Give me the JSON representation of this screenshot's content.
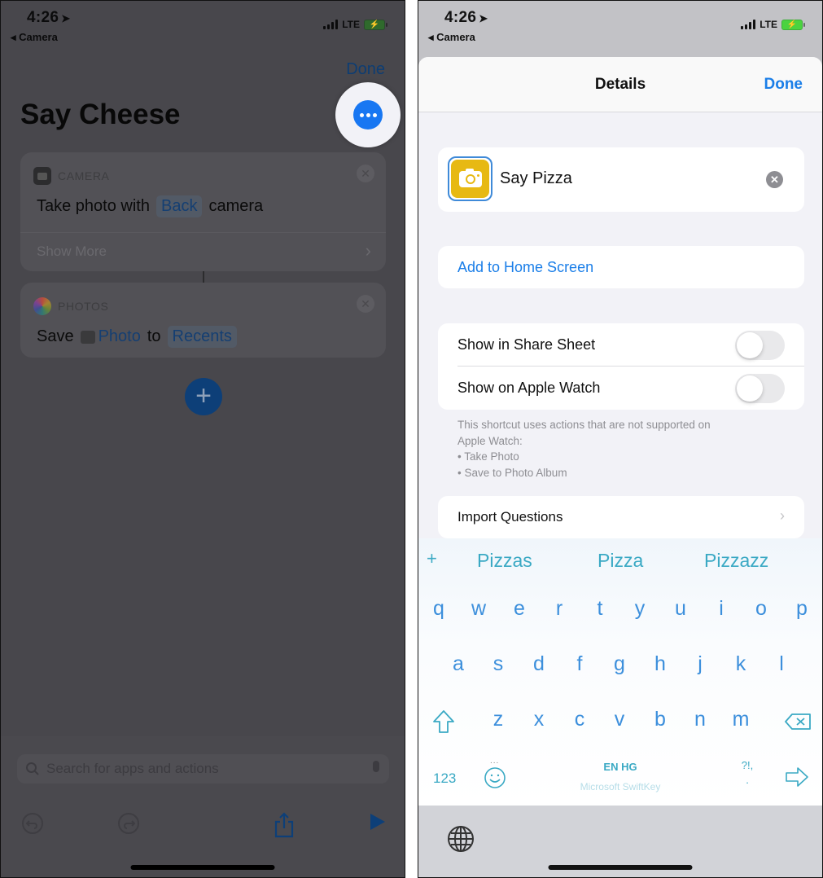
{
  "left_screen": {
    "status_bar": {
      "time": "4:26",
      "back_label": "◂ Camera",
      "network": "LTE"
    },
    "done_label": "Done",
    "title": "Say Cheese",
    "more_button_icon": "ellipsis-icon",
    "actions": [
      {
        "app": "CAMERA",
        "icon": "camera-app-icon",
        "text_before": "Take photo with",
        "param": "Back",
        "text_after": "camera",
        "show_more_label": "Show More"
      },
      {
        "app": "PHOTOS",
        "icon": "photos-app-icon",
        "text_before": "Save",
        "param": "Photo",
        "text_mid": "to",
        "param2": "Recents"
      }
    ],
    "add_button_label": "+",
    "search_placeholder": "Search for apps and actions",
    "toolbar": [
      "undo-icon",
      "redo-icon",
      "share-icon",
      "play-icon"
    ]
  },
  "right_screen": {
    "status_bar": {
      "time": "4:26",
      "back_label": "◂ Camera",
      "network": "LTE"
    },
    "sheet": {
      "title": "Details",
      "done_label": "Done",
      "shortcut_name": "Say Pizza",
      "icon_color": "#e7b913",
      "add_home_label": "Add to Home Screen",
      "toggles": [
        {
          "label": "Show in Share Sheet",
          "on": false
        },
        {
          "label": "Show on Apple Watch",
          "on": false
        }
      ],
      "note_lines": [
        "This shortcut uses actions that are not supported on",
        "Apple Watch:",
        "• Take Photo",
        "• Save to Photo Album"
      ],
      "import_label": "Import Questions"
    },
    "keyboard": {
      "suggestions": [
        "Pizzas",
        "Pizza",
        "Pizzazz"
      ],
      "plus": "+",
      "rows": [
        [
          "q",
          "w",
          "e",
          "r",
          "t",
          "y",
          "u",
          "i",
          "o",
          "p"
        ],
        [
          "a",
          "s",
          "d",
          "f",
          "g",
          "h",
          "j",
          "k",
          "l"
        ],
        [
          "z",
          "x",
          "c",
          "v",
          "b",
          "n",
          "m"
        ]
      ],
      "numbers_label": "123",
      "emoji_dots": "...",
      "language_label": "EN HG",
      "brand_label": "Microsoft SwiftKey",
      "punct_top": "?!,",
      "punct_bottom": ".",
      "key_color": "#3c8fdc",
      "accent_color": "#3aa9c4"
    }
  },
  "colors": {
    "ios_blue": "#1a7ee8",
    "more_button": "#1877f2"
  }
}
